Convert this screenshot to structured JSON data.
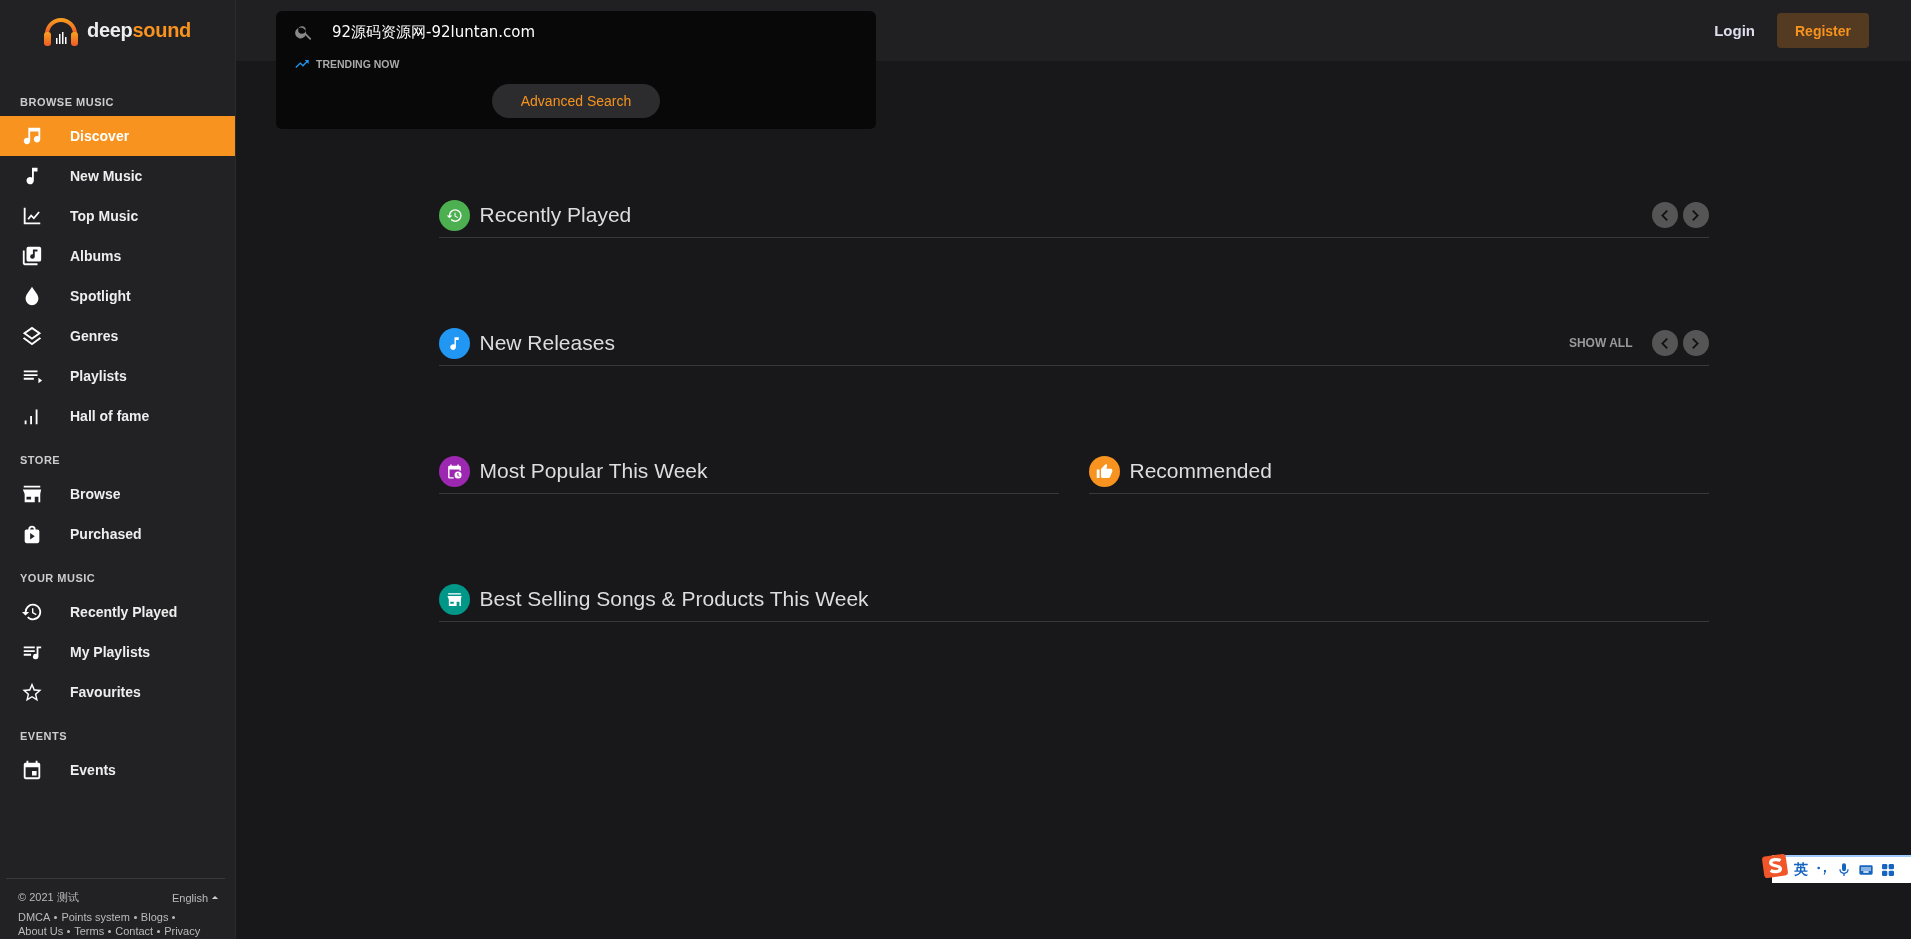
{
  "logo": {
    "text_light": "deep",
    "text_accent": "sound"
  },
  "sidebar": {
    "groups": [
      {
        "label": "BROWSE MUSIC",
        "items": [
          {
            "label": "Discover",
            "selected": true
          },
          {
            "label": "New Music",
            "selected": false
          },
          {
            "label": "Top Music",
            "selected": false
          },
          {
            "label": "Albums",
            "selected": false
          },
          {
            "label": "Spotlight",
            "selected": false
          },
          {
            "label": "Genres",
            "selected": false
          },
          {
            "label": "Playlists",
            "selected": false
          },
          {
            "label": "Hall of fame",
            "selected": false
          }
        ]
      },
      {
        "label": "STORE",
        "items": [
          {
            "label": "Browse",
            "selected": false
          },
          {
            "label": "Purchased",
            "selected": false
          }
        ]
      },
      {
        "label": "YOUR MUSIC",
        "items": [
          {
            "label": "Recently Played",
            "selected": false
          },
          {
            "label": "My Playlists",
            "selected": false
          },
          {
            "label": "Favourites",
            "selected": false
          }
        ]
      },
      {
        "label": "EVENTS",
        "items": [
          {
            "label": "Events",
            "selected": false
          }
        ]
      }
    ],
    "footer": {
      "copyright": "© 2021 测试",
      "language": "English",
      "links": [
        "DMCA",
        "Points system",
        "Blogs",
        "About Us",
        "Terms",
        "Contact",
        "Privacy"
      ]
    }
  },
  "search": {
    "value": "92源码资源网-92luntan.com",
    "trending_label": "TRENDING NOW",
    "advanced_button": "Advanced Search"
  },
  "header": {
    "login": "Login",
    "register": "Register"
  },
  "section_rows": [
    [
      {
        "title": "Recently Played",
        "color": "#4caf50",
        "arrows": true
      }
    ],
    [
      {
        "title": "New Releases",
        "color": "#2196f3",
        "show_all": "SHOW ALL",
        "arrows": true
      }
    ],
    [
      {
        "title": "Most Popular This Week",
        "color": "#9c27b0",
        "arrows": false
      },
      {
        "title": "Recommended",
        "color": "#f7931e",
        "arrows": false
      }
    ],
    [
      {
        "title": "Best Selling Songs & Products This Week",
        "color": "#009688",
        "arrows": false
      }
    ]
  ],
  "ime_bar": {
    "mode": "英"
  }
}
